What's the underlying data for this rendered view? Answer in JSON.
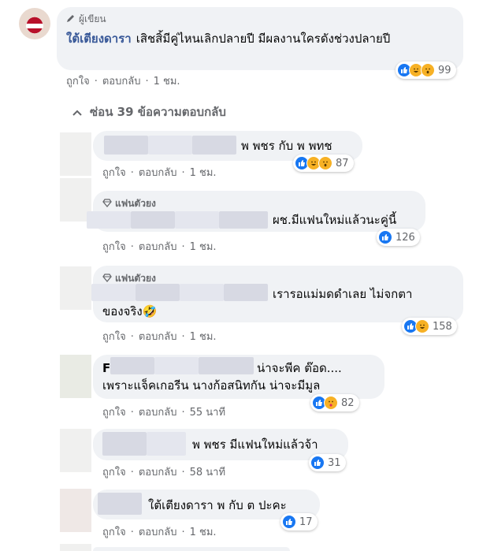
{
  "main_comment": {
    "badge": "ผู้เขียน",
    "author": "ใต้เตียงดารา",
    "text": "เสิชสิ้มีคู่ไหนเลิกปลายปี มีผลงานใครดังช่วงปลายปี",
    "actions": {
      "like": "ถูกใจ",
      "reply": "ตอบกลับ",
      "time": "1 ชม."
    },
    "reaction_count": "99",
    "reactions": [
      "like-icon",
      "haha-icon",
      "wow-icon"
    ]
  },
  "hide_replies_label": "ซ่อน 39 ข้อความตอบกลับ",
  "replies": [
    {
      "text": "พ พชร กับ พ พทช",
      "like": "ถูกใจ",
      "reply": "ตอบกลับ",
      "time": "1 ชม.",
      "count": "87"
    },
    {
      "badge": "แฟนตัวยง",
      "text": "ผช.มีแฟนใหม่แล้วนะคู่นี้",
      "like": "ถูกใจ",
      "reply": "ตอบกลับ",
      "time": "1 ชม.",
      "count": "126"
    },
    {
      "badge": "แฟนตัวยง",
      "text": "เรารอแม่มดดำเลย ไม่จกตา",
      "text2": "ของจริง🤣",
      "like": "ถูกใจ",
      "reply": "ตอบกลับ",
      "time": "1 ชม.",
      "count": "158"
    },
    {
      "lead": "F",
      "text": "น่าจะพีค ต๊อด....",
      "text2": "เพราะแจ็คเกอรีน นางก้อสนิทกัน น่าจะมีมูล",
      "like": "ถูกใจ",
      "reply": "ตอบกลับ",
      "time": "55 นาที",
      "count": "82"
    },
    {
      "text": "พ พชร มีแฟนใหม่แล้วจ้า",
      "like": "ถูกใจ",
      "reply": "ตอบกลับ",
      "time": "58 นาที",
      "count": "31"
    },
    {
      "text": "ใต้เตียงดารา พ กับ ต ปะคะ",
      "like": "ถูกใจ",
      "reply": "ตอบกลับ",
      "time": "1 ชม.",
      "count": "17"
    }
  ],
  "colors": {
    "like": "#1877f2",
    "haha": "#f7b125",
    "bubble": "#f0f2f5",
    "meta": "#65676b",
    "link": "#385898"
  }
}
